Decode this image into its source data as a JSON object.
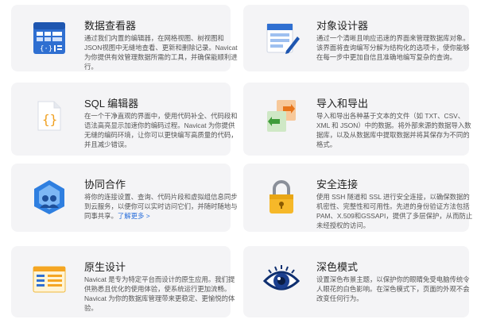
{
  "cards": [
    {
      "title": "数据查看器",
      "desc": "通过我们内置的编辑器，在网格视图、树视图和JSON视图中无缝地查看、更新和删除记录。Navicat 为你提供有效管理数据所需的工具，并确保能顺利进行。",
      "icon": "data-viewer-icon"
    },
    {
      "title": "对象设计器",
      "desc": "通过一个清晰且响应迅速的界面来管理数据库对象。该界面将查询编写分解为结构化的选项卡，使你能够在每一步中更加自信且准确地编写复杂的查询。",
      "icon": "object-designer-icon"
    },
    {
      "title": "SQL 编辑器",
      "desc": "在一个干净直观的界面中，使用代码补全、代码段和语法高亮显示加速你的编码过程。Navicat 为你提供无缝的编码环境，让你可以更快编写高质量的代码，并且减少错误。",
      "icon": "sql-editor-icon"
    },
    {
      "title": "导入和导出",
      "desc": "导入和导出各种基于文本的文件（如 TXT、CSV、XML 和 JSON）中的数据。将外部来源的数据导入数据库，以及从数据库中提取数据并将其保存为不同的格式。",
      "icon": "import-export-icon"
    },
    {
      "title": "协同合作",
      "desc": "将你的连接设置、查询、代码片段和虚拟组信息同步到云服务，以便你可以实时访问它们，并随时随地与同事共享。",
      "link": "了解更多 >",
      "icon": "collaboration-icon"
    },
    {
      "title": "安全连接",
      "desc": "使用 SSH 隧道和 SSL 进行安全连接，以确保数据的机密性、完整性和可用性。先进的身份验证方法包括 PAM、X.509和GSSAPI，提供了多层保护，从而防止未经授权的访问。",
      "icon": "lock-icon"
    },
    {
      "title": "原生设计",
      "desc": "Navicat 是专为特定平台而设计的原生应用。我们提供熟悉且优化的使用体验，使系统运行更加流畅。Navicat 为你的数据库管理带来更稳定、更愉悦的体验。",
      "icon": "native-design-icon"
    },
    {
      "title": "深色模式",
      "desc": "设置深色布景主题，以保护你的眼睛免受电脑传统令人眼花的白色影响。在深色模式下，页面的外观不会改变任何行为。",
      "icon": "eye-icon"
    }
  ]
}
